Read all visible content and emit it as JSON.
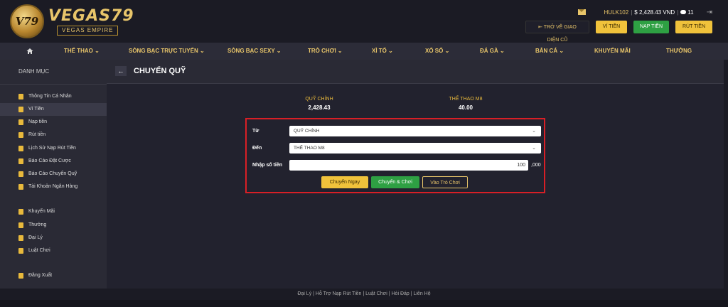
{
  "brand": {
    "name": "VEGAS79",
    "tagline": "VEGAS EMPIRE",
    "emblem_text": "V79"
  },
  "userbar": {
    "username": "HULK102",
    "balance": "$ 2,428.43 VND",
    "messages": "11",
    "sep": "|"
  },
  "header_actions": {
    "old_ui": "⇤ TRỞ VỀ GIAO DIỆN CŨ",
    "wallet": "VÍ TIỀN",
    "deposit": "NẠP TIỀN",
    "withdraw": "RÚT TIỀN"
  },
  "nav": [
    {
      "label": "THỂ THAO ⌄"
    },
    {
      "label": "SÒNG BẠC TRỰC TUYẾN ⌄"
    },
    {
      "label": "SÒNG BẠC SEXY ⌄"
    },
    {
      "label": "TRÒ CHƠI ⌄"
    },
    {
      "label": "XÌ TỐ ⌄"
    },
    {
      "label": "XỔ SỐ ⌄"
    },
    {
      "label": "ĐÁ GÀ ⌄"
    },
    {
      "label": "BẮN CÁ ⌄"
    },
    {
      "label": "KHUYẾN MÃI"
    },
    {
      "label": "THƯỞNG"
    }
  ],
  "sidebar": {
    "heading": "DANH MỤC",
    "items": [
      {
        "label": "Thông Tin Cá Nhân"
      },
      {
        "label": "Ví Tiền"
      },
      {
        "label": "Nạp tiền"
      },
      {
        "label": "Rút tiền"
      },
      {
        "label": "Lịch Sử Nạp Rút Tiền"
      },
      {
        "label": "Báo Cáo Đặt Cược"
      },
      {
        "label": "Báo Cáo Chuyển Quỹ"
      },
      {
        "label": "Tài Khoản Ngân Hàng"
      },
      {
        "label": "Khuyến Mãi"
      },
      {
        "label": "Thưởng"
      },
      {
        "label": "Đại Lý"
      },
      {
        "label": "Luật Chơi"
      },
      {
        "label": "Đăng Xuất"
      }
    ]
  },
  "page": {
    "title": "CHUYỂN QUỸ",
    "back": "←"
  },
  "balances": [
    {
      "label": "QUỸ CHÍNH",
      "value": "2,428.43"
    },
    {
      "label": "THỂ THAO M8",
      "value": "40.00"
    }
  ],
  "form": {
    "from_label": "Từ",
    "from_value": "QUỸ CHÍNH",
    "to_label": "Đến",
    "to_value": "THỂ THAO M8",
    "amount_label": "Nhập số tiền",
    "amount_value": "100",
    "amount_suffix": ",000",
    "btn_transfer": "Chuyển Ngay",
    "btn_transfer_play": "Chuyển & Chơi",
    "btn_play": "Vào Trò Chơi"
  },
  "footer": {
    "links": "Đại Lý  |  Hỗ Trợ Nạp Rút Tiền  |  Luật Chơi  |  Hỏi Đáp  |  Liên Hệ"
  },
  "colors": {
    "gold": "#e8c56a",
    "accent_red": "#d81f26",
    "green": "#2ea043",
    "yellow": "#f0c23b"
  }
}
